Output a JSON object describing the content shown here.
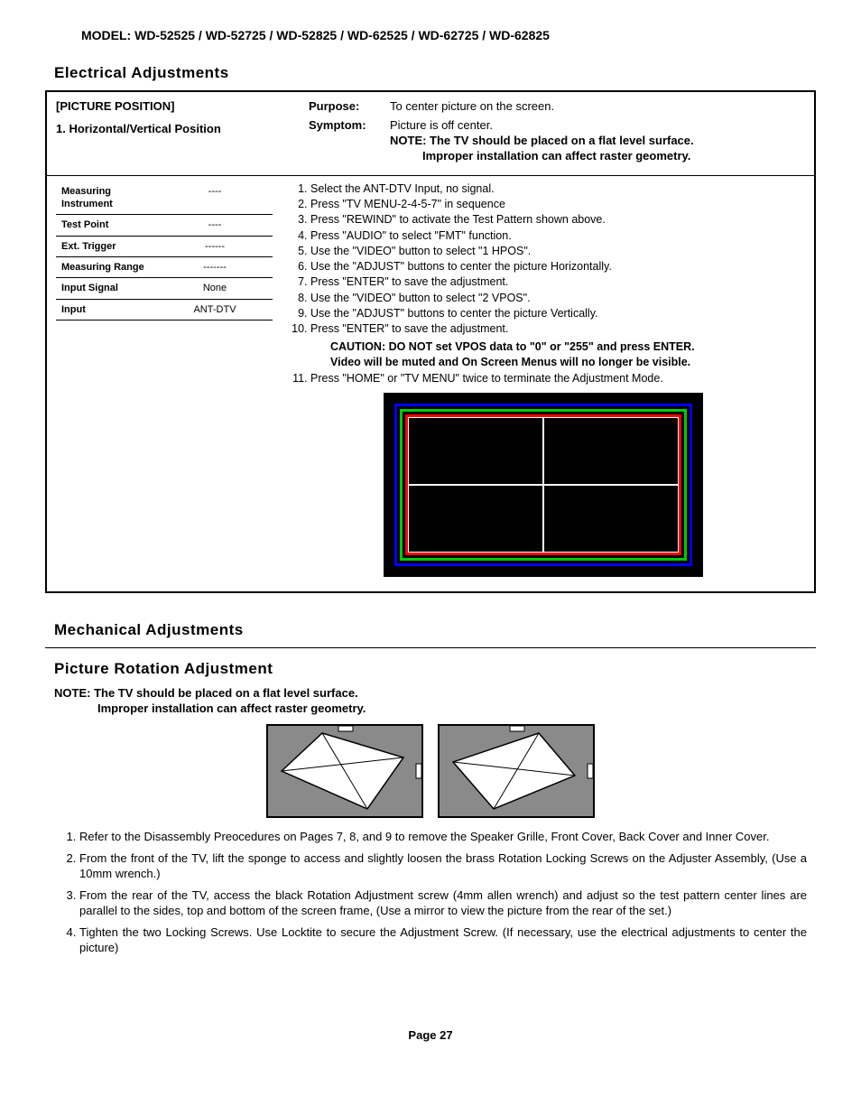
{
  "model_line": "MODEL: WD-52525 / WD-52725 / WD-52825 / WD-62525 / WD-62725 / WD-62825",
  "sec1_title": "Electrical Adjustments",
  "box": {
    "heading": "[PICTURE POSITION]",
    "sub": "1. Horizontal/Vertical Position",
    "purpose_lbl": "Purpose:",
    "purpose_val": "To center picture on the screen.",
    "symptom_lbl": "Symptom:",
    "symptom_val": "Picture is off center.",
    "note1": "NOTE:  The TV should be placed on a flat level surface.",
    "note2": "Improper installation can affect raster geometry."
  },
  "meas": [
    {
      "k": "Measuring Instrument",
      "v": "----"
    },
    {
      "k": "Test Point",
      "v": "----"
    },
    {
      "k": "Ext. Trigger",
      "v": "------"
    },
    {
      "k": "Measuring Range",
      "v": "-------"
    },
    {
      "k": "Input Signal",
      "v": "None"
    },
    {
      "k": "Input",
      "v": "ANT-DTV"
    }
  ],
  "steps": [
    "Select the ANT-DTV Input, no signal.",
    "Press \"TV MENU-2-4-5-7\" in sequence",
    "Press \"REWIND\" to activate the Test Pattern shown above.",
    "Press \"AUDIO\" to select \"FMT\" function.",
    "Use the \"VIDEO\" button to select \"1 HPOS\".",
    "Use the \"ADJUST\" buttons to center the picture Horizontally.",
    "Press \"ENTER\" to save the adjustment.",
    "Use the \"VIDEO\" button to select \"2 VPOS\".",
    "Use the \"ADJUST\" buttons to center the picture Vertically.",
    "Press \"ENTER\" to save the adjustment."
  ],
  "caution1": "CAUTION:  DO NOT set VPOS data to \"0\" or \"255\" and press ENTER.",
  "caution2": "Video will be muted and On Screen Menus will no longer be visible.",
  "step11": "Press \"HOME\" or \"TV MENU\" twice to terminate the Adjustment Mode.",
  "sec2_title": "Mechanical Adjustments",
  "sec3_title": "Picture Rotation Adjustment",
  "mech_note_lbl": "NOTE:",
  "mech_note1": "The TV should be placed on a flat level surface.",
  "mech_note2": "Improper installation can affect raster geometry.",
  "mech_steps": [
    "Refer to the Disassembly Preocedures on Pages 7, 8, and 9 to remove the Speaker Grille, Front Cover, Back Cover and Inner Cover.",
    "From the front of the TV, lift the sponge to access and slightly loosen the brass Rotation Locking Screws on the Adjuster Assembly,                    (Use a 10mm wrench.)",
    "From the rear of the TV, access the black Rotation Adjustment screw (4mm allen wrench) and adjust so the test pattern center lines are parallel to the sides, top and bottom of the screen frame,                  (Use a mirror to view the picture from the rear of the set.)",
    "Tighten the two Locking Screws.  Use Locktite to secure the Adjustment Screw.  (If necessary, use the electrical adjustments to center the picture)"
  ],
  "page_num": "Page 27"
}
